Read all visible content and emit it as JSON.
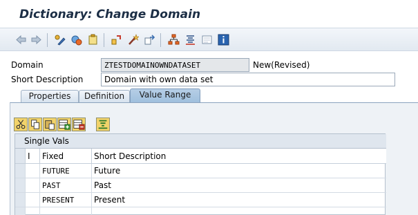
{
  "window": {
    "title": "Dictionary: Change Domain"
  },
  "toolbar": {
    "icons": [
      "back-icon",
      "forward-icon",
      "other-object-icon",
      "display-change-icon",
      "activate-icon",
      "check-icon",
      "where-used-icon",
      "navigate-icon",
      "hierarchy-icon",
      "list-icon",
      "docu-icon",
      "info-icon"
    ]
  },
  "form": {
    "domain_label": "Domain",
    "domain_value": "ZTESTDOMAINOWNDATASET",
    "domain_status": "New(Revised)",
    "short_desc_label": "Short Description",
    "short_desc_value": "Domain with own data set"
  },
  "tabs": [
    {
      "label": "Properties",
      "active": false
    },
    {
      "label": "Definition",
      "active": false
    },
    {
      "label": "Value Range",
      "active": true
    }
  ],
  "table_toolbar": {
    "icons": [
      "cut-icon",
      "copy-icon",
      "paste-icon",
      "insert-row-icon",
      "delete-row-icon",
      "filter-icon"
    ]
  },
  "single_vals": {
    "caption": "Single Vals",
    "columns": [
      "I",
      "Fixed",
      "Short Description"
    ],
    "rows": [
      {
        "fixed": "FUTURE",
        "desc": "Future"
      },
      {
        "fixed": "PAST",
        "desc": "Past"
      },
      {
        "fixed": "PRESENT",
        "desc": "Present"
      },
      {
        "fixed": "",
        "desc": ""
      }
    ]
  },
  "colors": {
    "title": "#1c2e45",
    "active_tab": "#9ebfdd",
    "toolbar_yellow": "#f2d36a"
  }
}
